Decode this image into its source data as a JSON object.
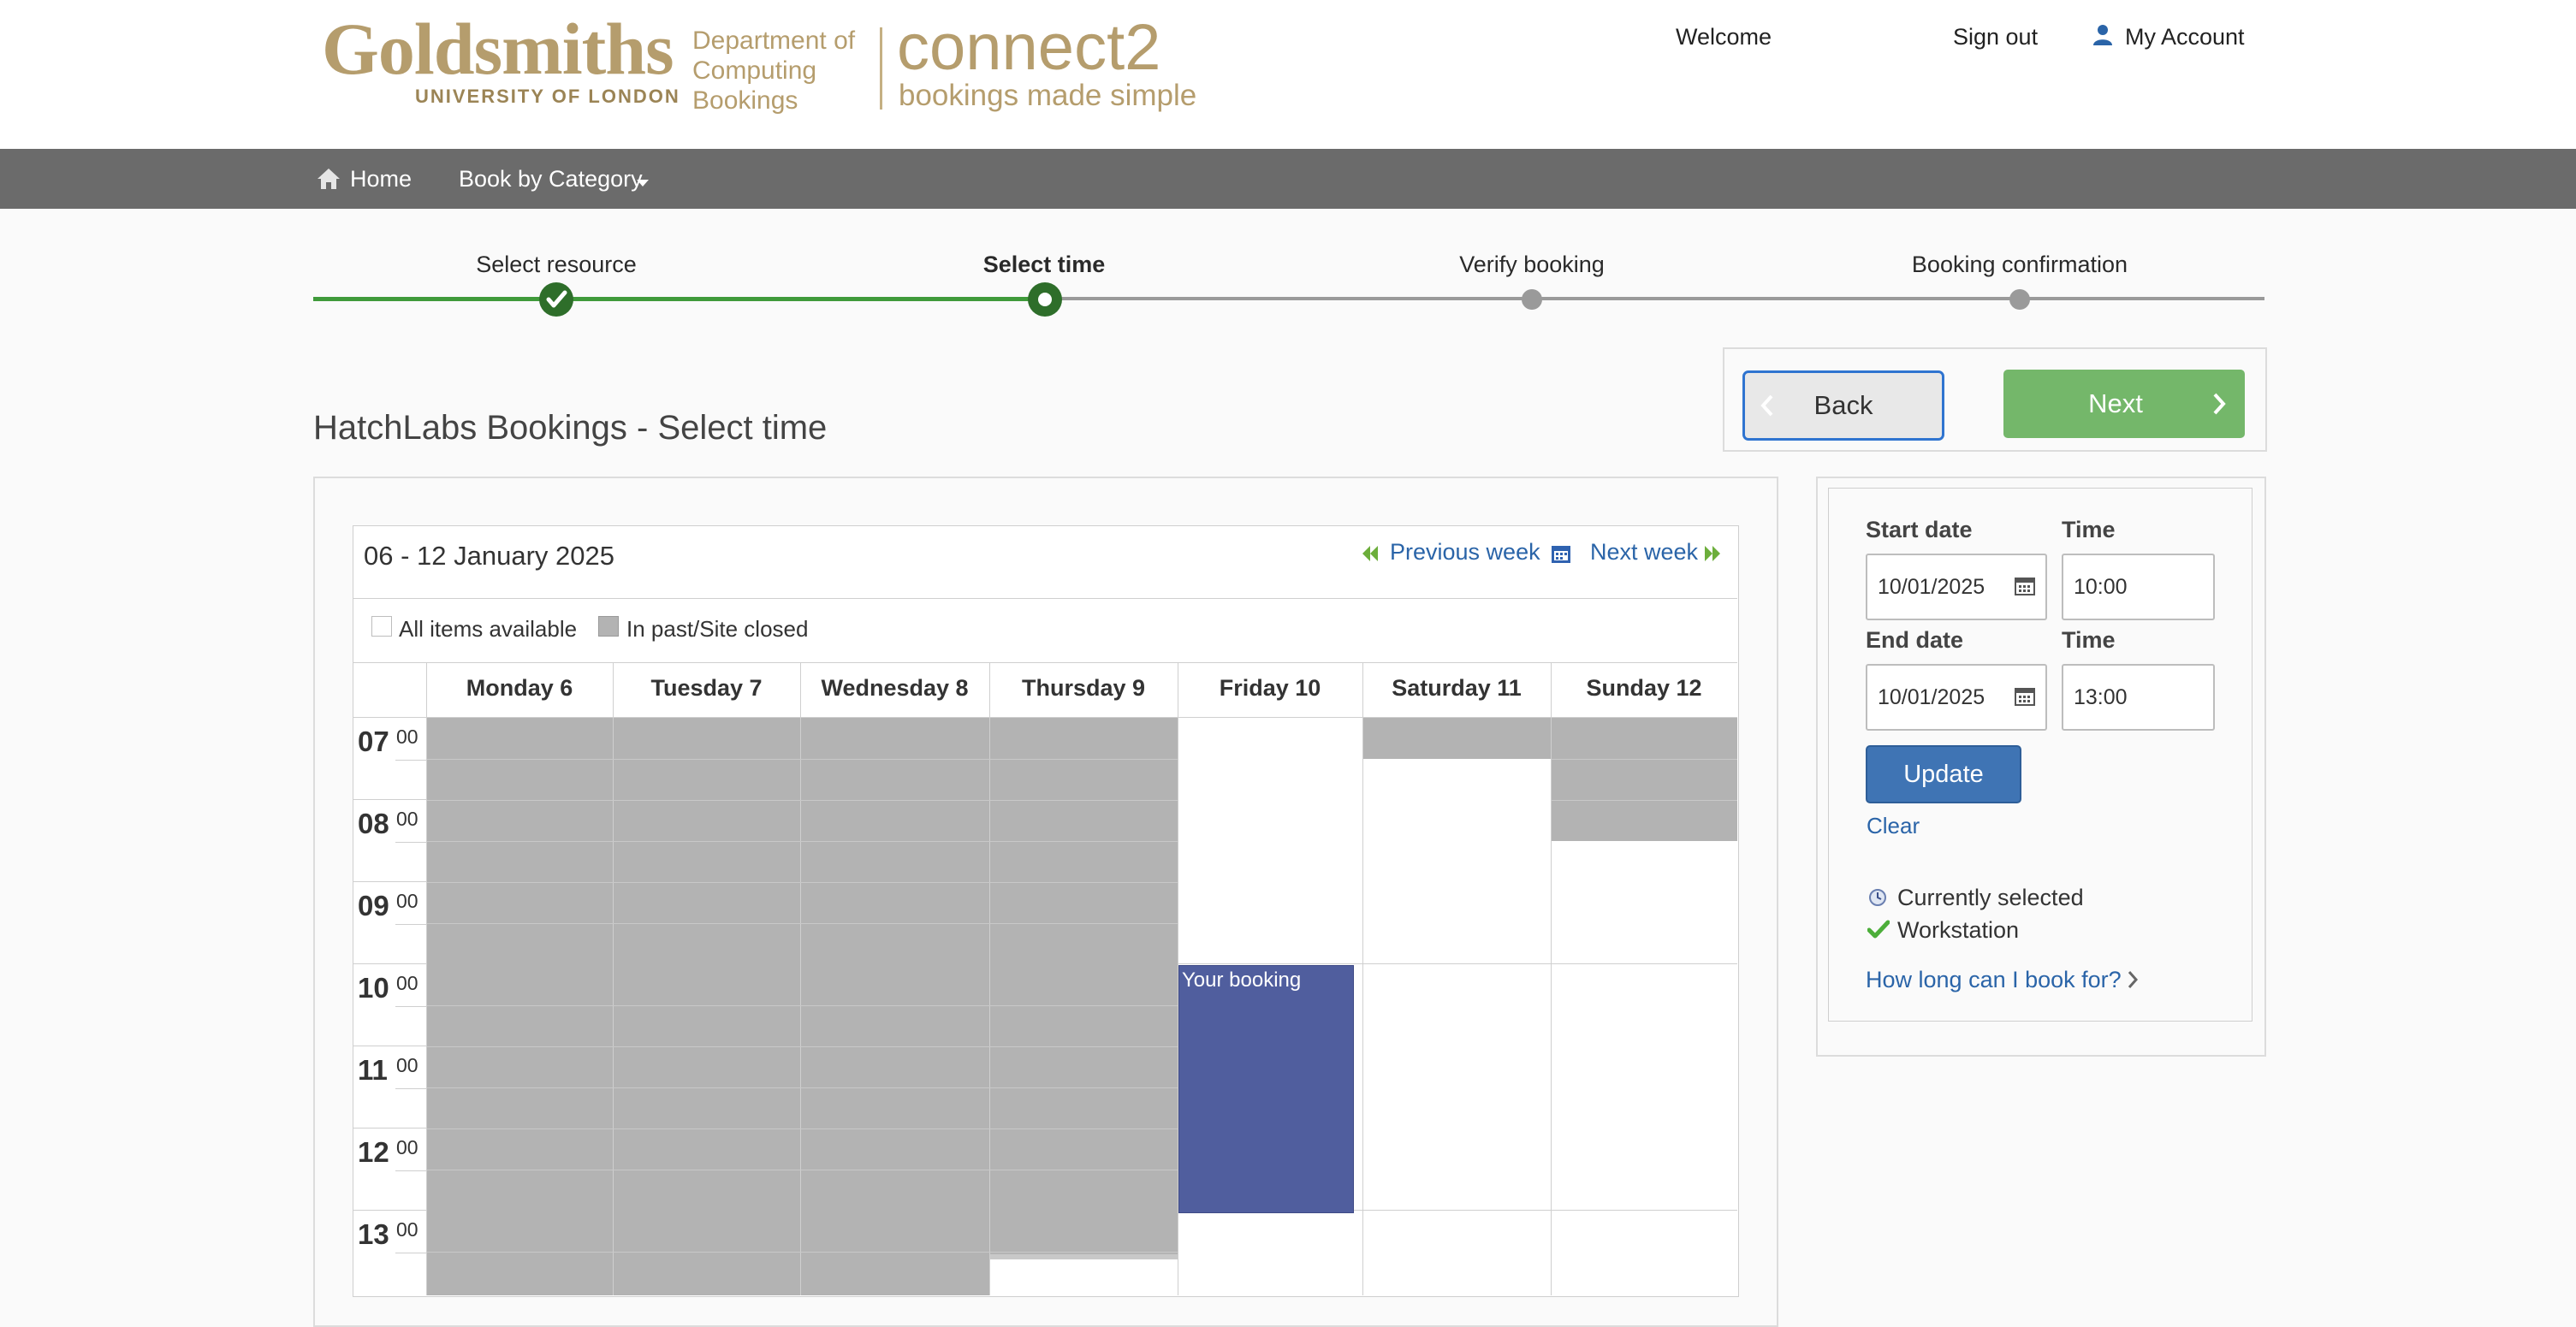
{
  "header": {
    "brand_name": "Goldsmiths",
    "brand_sub": "UNIVERSITY OF LONDON",
    "dept_line1": "Department of",
    "dept_line2": "Computing",
    "dept_line3": "Bookings",
    "product_name": "connect2",
    "product_tagline": "bookings made simple",
    "welcome": "Welcome",
    "sign_out": "Sign out",
    "my_account": "My Account"
  },
  "nav": {
    "home": "Home",
    "book_by_category": "Book by Category"
  },
  "steps": [
    {
      "label": "Select resource",
      "state": "done"
    },
    {
      "label": "Select time",
      "state": "current"
    },
    {
      "label": "Verify booking",
      "state": "pending"
    },
    {
      "label": "Booking confirmation",
      "state": "pending"
    }
  ],
  "actions": {
    "back": "Back",
    "next": "Next"
  },
  "page_title": "HatchLabs Bookings - Select time",
  "calendar": {
    "week_range": "06 - 12 January 2025",
    "previous_week": "Previous week",
    "next_week": "Next week",
    "legend_available": "All items available",
    "legend_closed": "In past/Site closed",
    "days": [
      "Monday 6",
      "Tuesday 7",
      "Wednesday 8",
      "Thursday 9",
      "Friday 10",
      "Saturday 11",
      "Sunday 12"
    ],
    "hours": [
      "07",
      "08",
      "09",
      "10",
      "11",
      "12",
      "13"
    ],
    "minutes": "00",
    "booking_label": "Your booking"
  },
  "booking_form": {
    "start_date_label": "Start date",
    "start_time_label": "Time",
    "start_date": "10/01/2025",
    "start_time": "10:00",
    "end_date_label": "End date",
    "end_time_label": "Time",
    "end_date": "10/01/2025",
    "end_time": "13:00",
    "update": "Update",
    "clear": "Clear",
    "currently_selected": "Currently selected",
    "workstation": "Workstation",
    "how_long": "How long can I book for?"
  },
  "colors": {
    "brand_gold": "#b59d6d",
    "nav_bg": "#6b6b6b",
    "step_green": "#3f9a3a",
    "next_green": "#74b76a",
    "booking_blue": "#505e9e",
    "closed_grey": "#b3b3b3",
    "link_blue": "#2a64a8"
  }
}
